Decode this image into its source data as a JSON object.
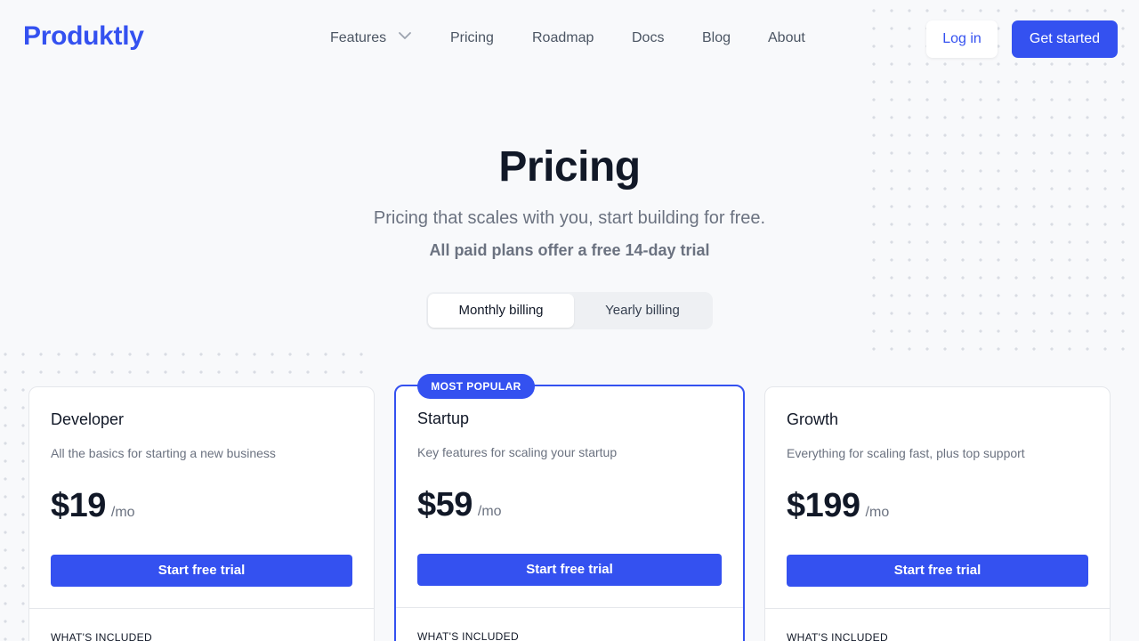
{
  "nav": {
    "logo": "Produktly",
    "links": [
      {
        "label": "Features",
        "has_dropdown": true
      },
      {
        "label": "Pricing"
      },
      {
        "label": "Roadmap"
      },
      {
        "label": "Docs"
      },
      {
        "label": "Blog"
      },
      {
        "label": "About"
      }
    ],
    "login_label": "Log in",
    "get_started_label": "Get started"
  },
  "hero": {
    "title": "Pricing",
    "subtitle": "Pricing that scales with you, start building for free.",
    "trial_note": "All paid plans offer a free 14-day trial"
  },
  "billing_toggle": {
    "options": [
      "Monthly billing",
      "Yearly billing"
    ],
    "selected": "Monthly billing"
  },
  "plans": [
    {
      "name": "Developer",
      "description": "All the basics for starting a new business",
      "price": "$19",
      "unit": "/mo",
      "cta": "Start free trial",
      "included_heading": "WHAT'S INCLUDED"
    },
    {
      "name": "Startup",
      "badge": "MOST POPULAR",
      "description": "Key features for scaling your startup",
      "price": "$59",
      "unit": "/mo",
      "cta": "Start free trial",
      "included_heading": "WHAT'S INCLUDED"
    },
    {
      "name": "Growth",
      "description": "Everything for scaling fast, plus top support",
      "price": "$199",
      "unit": "/mo",
      "cta": "Start free trial",
      "included_heading": "WHAT'S INCLUDED"
    }
  ],
  "colors": {
    "brand": "#3451f0",
    "background": "#f8f9fb",
    "text": "#111827",
    "muted": "#6b7280"
  },
  "icons": {
    "features_dropdown": "chevron-down-icon"
  }
}
